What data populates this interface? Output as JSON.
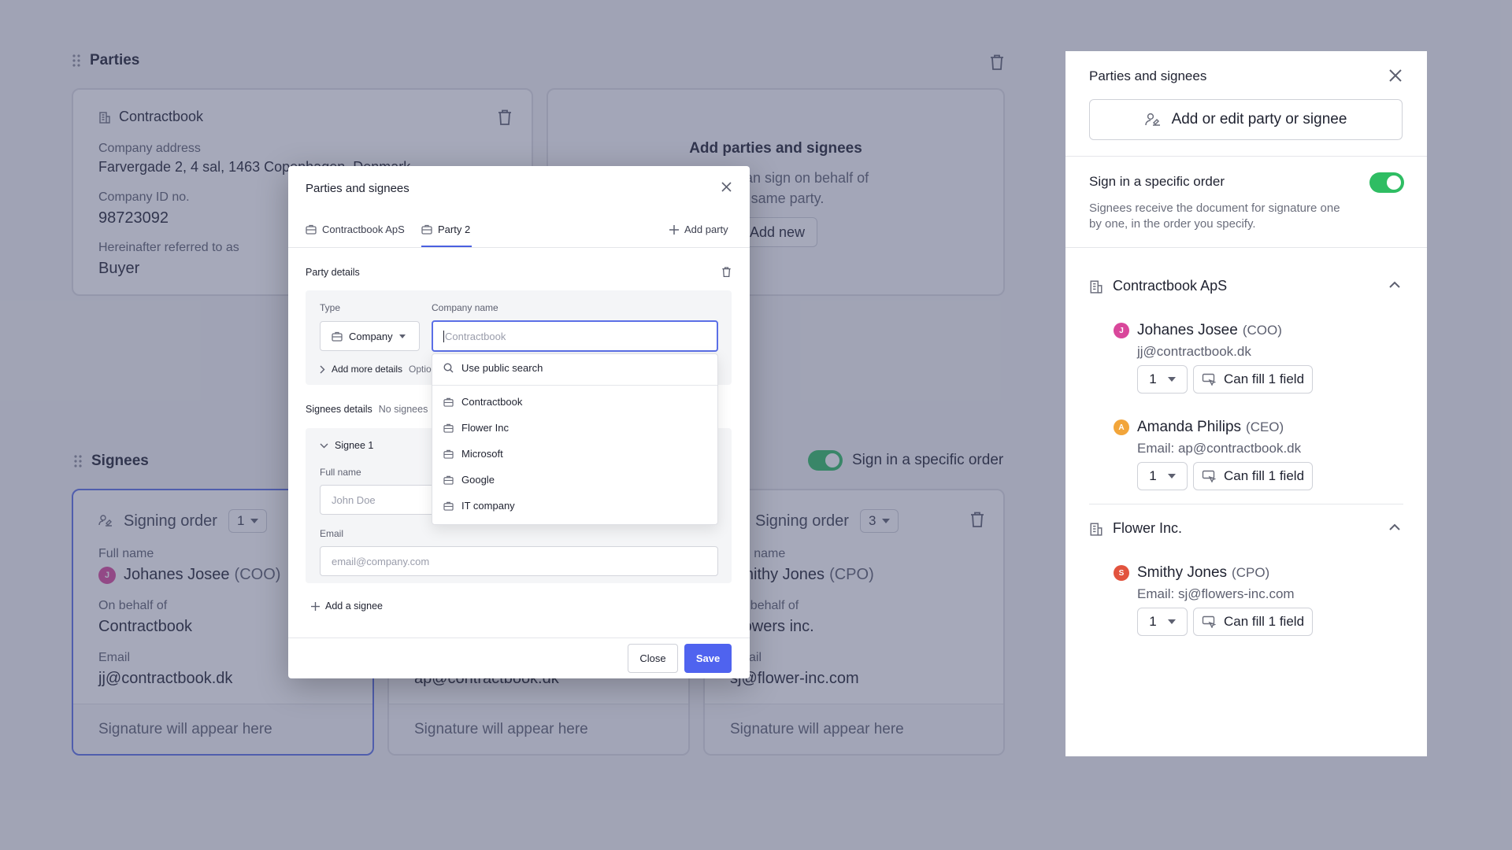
{
  "parties_section": {
    "title": "Parties",
    "party_card": {
      "name": "Contractbook",
      "address_label": "Company address",
      "address_value": "Farvergade 2, 4 sal, 1463 Copenhagen, Denmark",
      "company_id_label": "Company ID no.",
      "company_id_value": "98723092",
      "referred_label": "Hereinafter referred to as",
      "referred_value": "Buyer"
    },
    "add_card": {
      "title": "Add parties and signees",
      "text_line1": "Signees can sign on behalf of",
      "text_line2": "the same party.",
      "button": "Add new"
    }
  },
  "signees_section": {
    "title": "Signees",
    "order_toggle_label": "Sign in a specific order",
    "cards": [
      {
        "signing_order_label": "Signing order",
        "order": "1",
        "full_name_label": "Full name",
        "avatar_letter": "J",
        "name": "Johanes Josee",
        "role": "(COO)",
        "behalf_label": "On behalf of",
        "behalf_value": "Contractbook",
        "email_label": "Email",
        "email_value": "jj@contractbook.dk",
        "signature": "Signature will appear here"
      },
      {
        "email_value": "ap@contractbook.dk",
        "signature": "Signature will appear here"
      },
      {
        "signing_order_label": "Signing order",
        "order": "3",
        "full_name_label": "Full name",
        "name": "Smithy Jones",
        "role": "(CPO)",
        "behalf_label": "On behalf of",
        "behalf_value": "Flowers inc.",
        "email_label": "Email",
        "email_value": "sj@flower-inc.com",
        "signature": "Signature will appear here"
      }
    ]
  },
  "side_panel": {
    "title": "Parties and signees",
    "add_button": "Add or edit party or signee",
    "order_title": "Sign in a specific order",
    "order_desc_line1": "Signees receive the document for signature one",
    "order_desc_line2": "by one, in the order you specify.",
    "parties": [
      {
        "name": "Contractbook ApS",
        "signees": [
          {
            "avatar": "J",
            "name": "Johanes Josee",
            "role": "(COO)",
            "email": "jj@contractbook.dk",
            "order": "1",
            "fill": "Can fill 1 field"
          },
          {
            "avatar": "A",
            "name": "Amanda Philips",
            "role": "(CEO)",
            "email": "Email: ap@contractbook.dk",
            "order": "1",
            "fill": "Can fill 1 field"
          }
        ]
      },
      {
        "name": "Flower Inc.",
        "signees": [
          {
            "avatar": "S",
            "name": "Smithy Jones",
            "role": "(CPO)",
            "email": "Email: sj@flowers-inc.com",
            "order": "1",
            "fill": "Can fill 1 field"
          }
        ]
      }
    ]
  },
  "modal": {
    "title": "Parties and signees",
    "tabs": [
      "Contractbook ApS",
      "Party 2"
    ],
    "add_party": "Add party",
    "party_details_title": "Party details",
    "type_label": "Type",
    "type_value": "Company",
    "company_name_label": "Company name",
    "company_name_placeholder": "Contractbook",
    "add_more_details": "Add more details",
    "optional": "Optional",
    "signees_title": "Signees details",
    "signees_hint": "No signees",
    "signee_1": "Signee 1",
    "full_name_label": "Full name",
    "full_name_placeholder": "John Doe",
    "email_label": "Email",
    "email_placeholder": "email@company.com",
    "add_signee": "Add a signee",
    "close_button": "Close",
    "save_button": "Save",
    "dropdown": {
      "public_search": "Use public search",
      "options": [
        "Contractbook",
        "Flower Inc",
        "Microsoft",
        "Google",
        "IT company"
      ]
    }
  },
  "colors": {
    "accent": "#4f63ef",
    "toggle_on": "#2fbd63",
    "avatar_j": "#d9479b",
    "avatar_a": "#f2a53a",
    "avatar_s": "#e2533e",
    "overlay": "#464c6e"
  }
}
